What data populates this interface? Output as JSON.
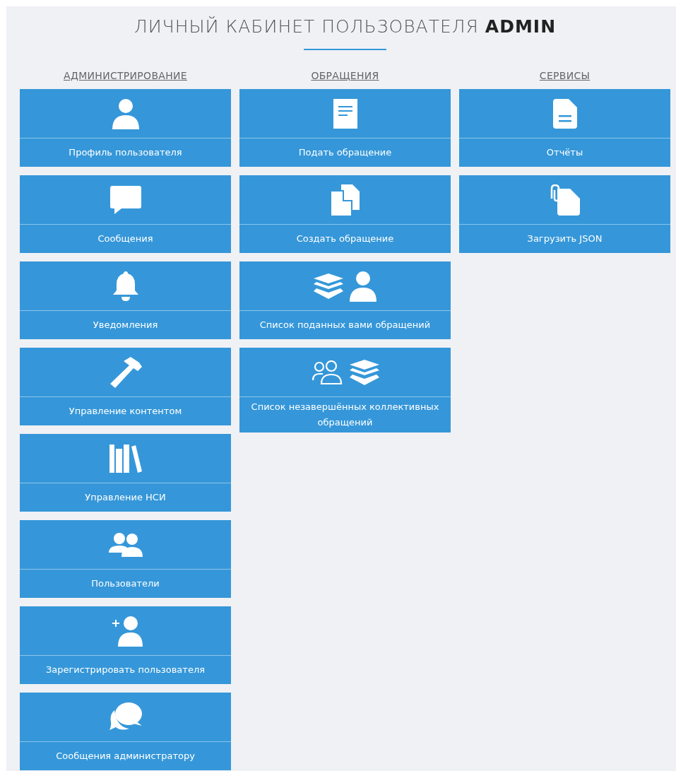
{
  "title": "ЛИЧНЫЙ КАБИНЕТ ПОЛЬЗОВАТЕЛЯ **ADMIN**",
  "columns": [
    {
      "heading": "АДМИНИСТРИРОВАНИЕ",
      "tiles": [
        {
          "label": "Профиль пользователя"
        },
        {
          "label": "Сообщения"
        },
        {
          "label": "Уведомления"
        },
        {
          "label": "Управление контентом"
        },
        {
          "label": "Управление НСИ"
        },
        {
          "label": "Пользователи"
        },
        {
          "label": "Зарегистрировать пользователя"
        },
        {
          "label": "Сообщения администратору"
        }
      ]
    },
    {
      "heading": "ОБРАЩЕНИЯ",
      "tiles": [
        {
          "label": "Подать обращение"
        },
        {
          "label": "Создать обращение"
        },
        {
          "label": "Список поданных вами обращений"
        },
        {
          "label": "Список незавершённых коллективных обращений"
        }
      ]
    },
    {
      "heading": "СЕРВИСЫ",
      "tiles": [
        {
          "label": "Отчёты"
        },
        {
          "label": "Загрузить JSON"
        }
      ]
    }
  ]
}
